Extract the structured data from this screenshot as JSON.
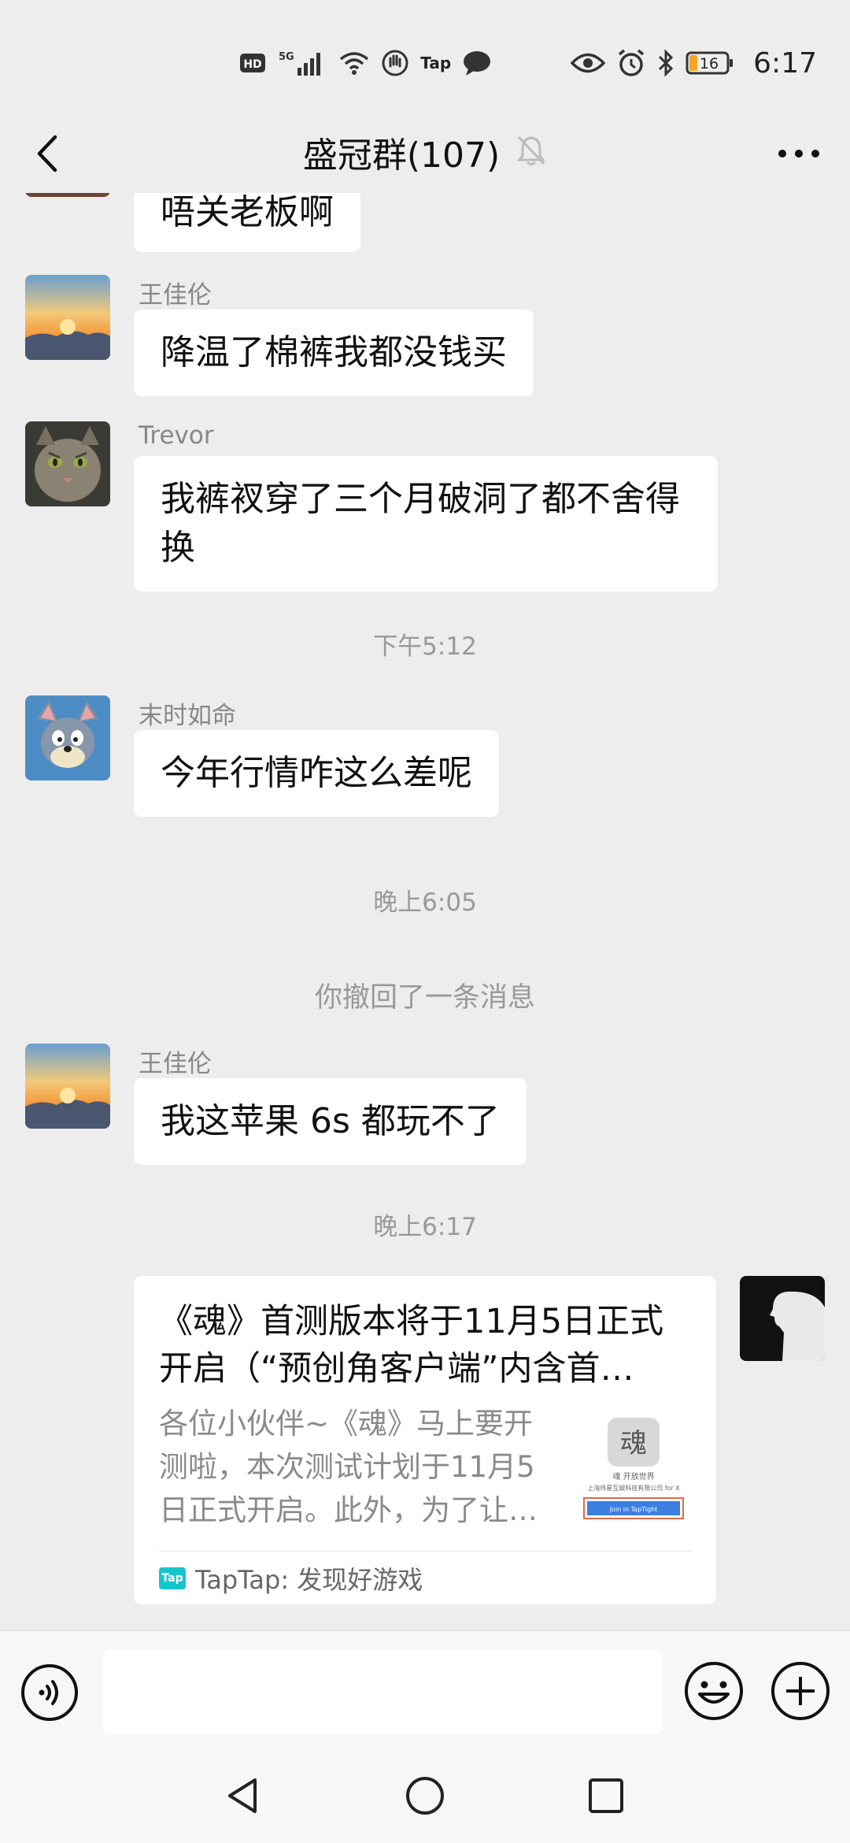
{
  "status_bar": {
    "hd": "HD",
    "network": "5G",
    "tap": "Tap",
    "battery": "16",
    "time": "6:17"
  },
  "header": {
    "title": "盛冠群(107)"
  },
  "messages": [
    {
      "text": "唔关老板啊"
    },
    {
      "sender": "王佳伦",
      "text": "降温了棉裤我都没钱买"
    },
    {
      "sender": "Trevor",
      "text": "我裤衩穿了三个月破洞了都不舍得换"
    },
    {
      "time": "下午5:12"
    },
    {
      "sender": "末时如命",
      "text": "今年行情咋这么差呢"
    },
    {
      "time": "晚上6:05"
    },
    {
      "system": "你撤回了一条消息"
    },
    {
      "sender": "王佳伦",
      "text": "我这苹果 6s 都玩不了"
    },
    {
      "time": "晚上6:17"
    }
  ],
  "card": {
    "title": "《魂》首测版本将于11月5日正式开启（“预创角客户端”内含首…",
    "description": "各位小伙伴~《魂》马上要开测啦，本次测试计划于11月5日正式开启。此外，为了让…",
    "thumb_logo": "魂",
    "thumb_caption": "魂 开放世界",
    "thumb_company": "上海炜星互娱科技有限公司 for X",
    "thumb_button": "Join in TapTight",
    "source_logo": "Tap",
    "source": "TapTap: 发现好游戏"
  },
  "input": {
    "placeholder": ""
  },
  "colors": {
    "background": "#ededed",
    "bubble": "#ffffff",
    "meta_text": "#999999",
    "taptap": "#15c5ce"
  }
}
